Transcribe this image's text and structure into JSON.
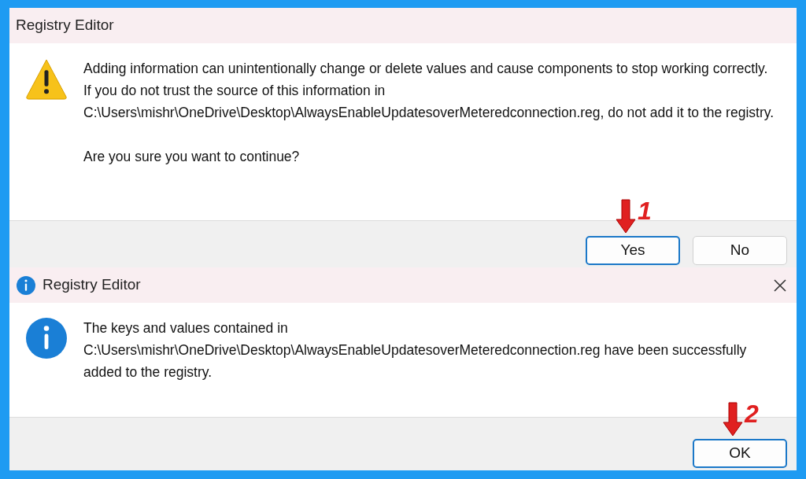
{
  "dialogs": [
    {
      "title": "Registry Editor",
      "kind": "warning",
      "paragraphs": [
        "Adding information can unintentionally change or delete values and cause components to stop working correctly. If you do not trust the source of this information in C:\\Users\\mishr\\OneDrive\\Desktop\\AlwaysEnableUpdatesoverMeteredconnection.reg, do not add it to the registry.",
        "Are you sure you want to continue?"
      ],
      "buttons": [
        {
          "label": "Yes",
          "default": true,
          "annotation": "1"
        },
        {
          "label": "No",
          "default": false
        }
      ]
    },
    {
      "title": "Registry Editor",
      "kind": "info",
      "paragraphs": [
        "The keys and values contained in C:\\Users\\mishr\\OneDrive\\Desktop\\AlwaysEnableUpdatesoverMeteredconnection.reg have been successfully added to the registry."
      ],
      "buttons": [
        {
          "label": "OK",
          "default": true,
          "annotation": "2"
        }
      ]
    }
  ]
}
